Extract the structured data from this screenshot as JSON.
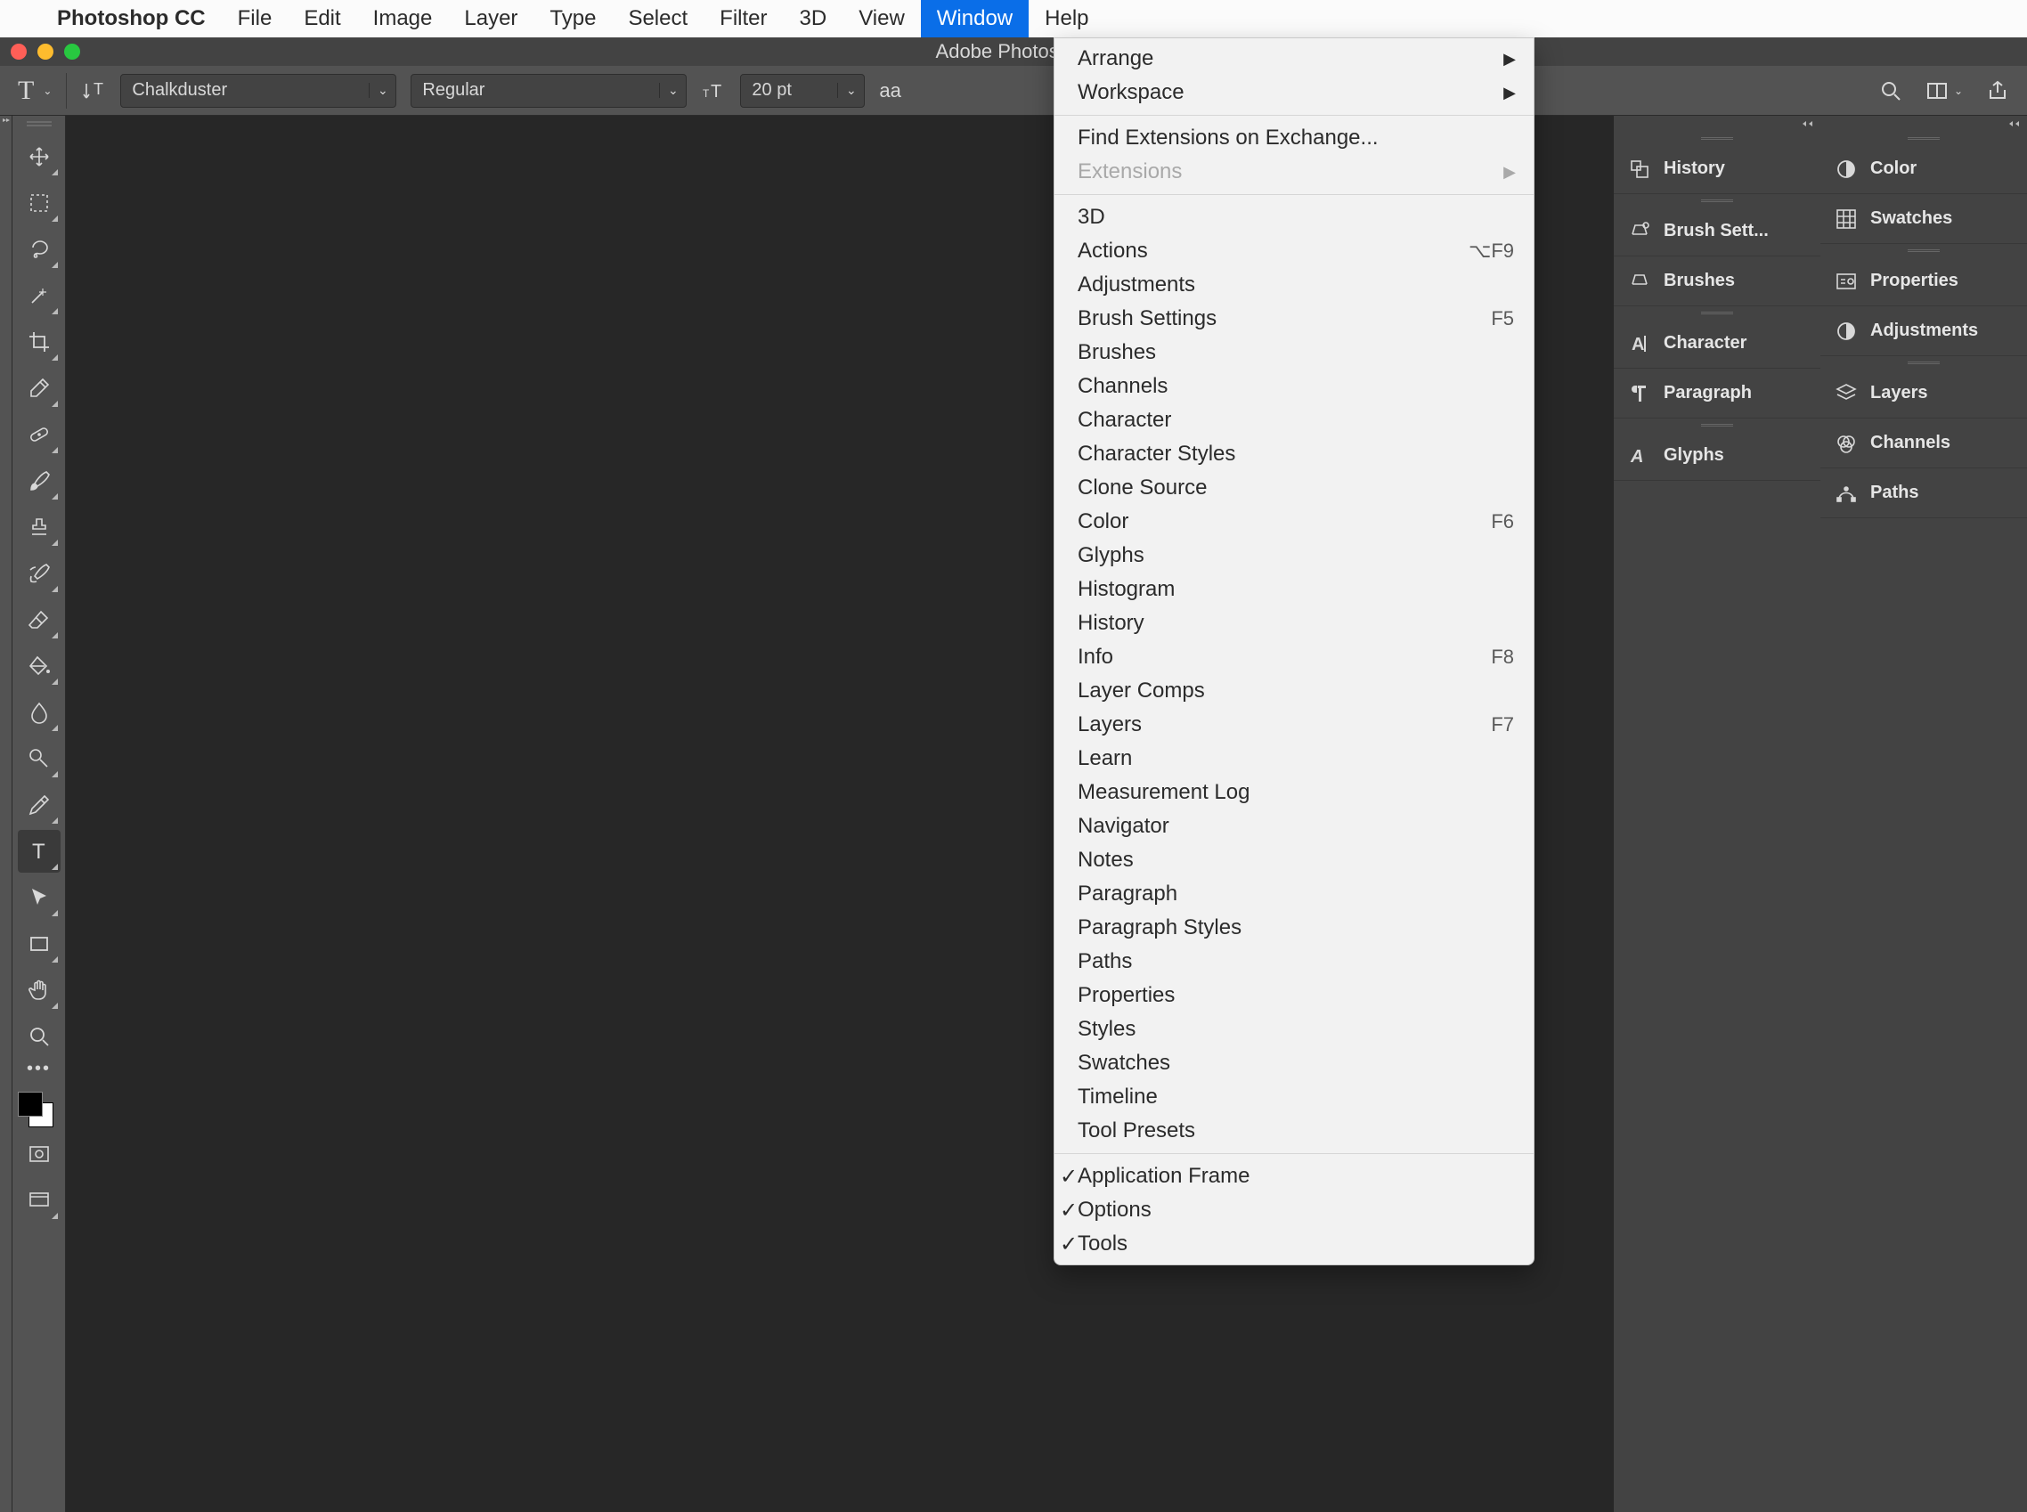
{
  "menubar": {
    "apple": "",
    "appname": "Photoshop CC",
    "items": [
      "File",
      "Edit",
      "Image",
      "Layer",
      "Type",
      "Select",
      "Filter",
      "3D",
      "View",
      "Window",
      "Help"
    ],
    "active": "Window"
  },
  "titlebar": {
    "windowTitle": "Adobe Photoshop"
  },
  "optbar": {
    "tool_letter": "T",
    "font_family": "Chalkduster",
    "font_style": "Regular",
    "font_size": "20 pt",
    "aa_label": "aa"
  },
  "dropdown": {
    "groups": [
      [
        {
          "label": "Arrange",
          "submenu": true
        },
        {
          "label": "Workspace",
          "submenu": true
        }
      ],
      [
        {
          "label": "Find Extensions on Exchange..."
        },
        {
          "label": "Extensions",
          "submenu": true,
          "disabled": true
        }
      ],
      [
        {
          "label": "3D"
        },
        {
          "label": "Actions",
          "shortcut": "⌥F9"
        },
        {
          "label": "Adjustments"
        },
        {
          "label": "Brush Settings",
          "shortcut": "F5"
        },
        {
          "label": "Brushes"
        },
        {
          "label": "Channels"
        },
        {
          "label": "Character"
        },
        {
          "label": "Character Styles"
        },
        {
          "label": "Clone Source"
        },
        {
          "label": "Color",
          "shortcut": "F6"
        },
        {
          "label": "Glyphs"
        },
        {
          "label": "Histogram"
        },
        {
          "label": "History"
        },
        {
          "label": "Info",
          "shortcut": "F8"
        },
        {
          "label": "Layer Comps"
        },
        {
          "label": "Layers",
          "shortcut": "F7"
        },
        {
          "label": "Learn"
        },
        {
          "label": "Measurement Log"
        },
        {
          "label": "Navigator"
        },
        {
          "label": "Notes"
        },
        {
          "label": "Paragraph"
        },
        {
          "label": "Paragraph Styles"
        },
        {
          "label": "Paths"
        },
        {
          "label": "Properties"
        },
        {
          "label": "Styles"
        },
        {
          "label": "Swatches"
        },
        {
          "label": "Timeline"
        },
        {
          "label": "Tool Presets"
        }
      ],
      [
        {
          "label": "Application Frame",
          "checked": true
        },
        {
          "label": "Options",
          "checked": true
        },
        {
          "label": "Tools",
          "checked": true
        }
      ]
    ]
  },
  "tools": [
    {
      "name": "move-tool",
      "svg": "move",
      "tri": true
    },
    {
      "name": "marquee-tool",
      "svg": "marquee",
      "tri": true
    },
    {
      "name": "lasso-tool",
      "svg": "lasso",
      "tri": true
    },
    {
      "name": "magic-wand-tool",
      "svg": "wand",
      "tri": true
    },
    {
      "name": "crop-tool",
      "svg": "crop",
      "tri": true
    },
    {
      "name": "eyedropper-tool",
      "svg": "eyedrop",
      "tri": true
    },
    {
      "name": "healing-brush-tool",
      "svg": "bandaid",
      "tri": true
    },
    {
      "name": "brush-tool",
      "svg": "brush",
      "tri": true
    },
    {
      "name": "clone-stamp-tool",
      "svg": "stamp",
      "tri": true
    },
    {
      "name": "history-brush-tool",
      "svg": "histbrush",
      "tri": true
    },
    {
      "name": "eraser-tool",
      "svg": "eraser",
      "tri": true
    },
    {
      "name": "gradient-tool",
      "svg": "bucket",
      "tri": true
    },
    {
      "name": "blur-tool",
      "svg": "blur",
      "tri": true
    },
    {
      "name": "dodge-tool",
      "svg": "dodge",
      "tri": true
    },
    {
      "name": "pen-tool",
      "svg": "pen",
      "tri": true
    },
    {
      "name": "type-tool",
      "svg": "typeT",
      "tri": true,
      "active": true
    },
    {
      "name": "path-select-tool",
      "svg": "pathsel",
      "tri": true
    },
    {
      "name": "shape-tool",
      "svg": "rect",
      "tri": true
    },
    {
      "name": "hand-tool",
      "svg": "hand",
      "tri": true
    },
    {
      "name": "zoom-tool",
      "svg": "zoom",
      "tri": false
    }
  ],
  "panelcols": [
    {
      "tabs": [
        [
          {
            "icon": "history",
            "label": "History"
          }
        ],
        [
          {
            "icon": "brushset",
            "label": "Brush Sett..."
          },
          {
            "icon": "brushes",
            "label": "Brushes"
          }
        ],
        [
          {
            "icon": "character",
            "label": "Character"
          },
          {
            "icon": "paragraph",
            "label": "Paragraph"
          }
        ],
        [
          {
            "icon": "glyphs",
            "label": "Glyphs"
          }
        ]
      ]
    },
    {
      "tabs": [
        [
          {
            "icon": "color",
            "label": "Color"
          },
          {
            "icon": "swatches",
            "label": "Swatches"
          }
        ],
        [
          {
            "icon": "properties",
            "label": "Properties"
          },
          {
            "icon": "adjust",
            "label": "Adjustments"
          }
        ],
        [
          {
            "icon": "layers",
            "label": "Layers"
          },
          {
            "icon": "channels",
            "label": "Channels"
          },
          {
            "icon": "paths",
            "label": "Paths"
          }
        ]
      ]
    }
  ]
}
